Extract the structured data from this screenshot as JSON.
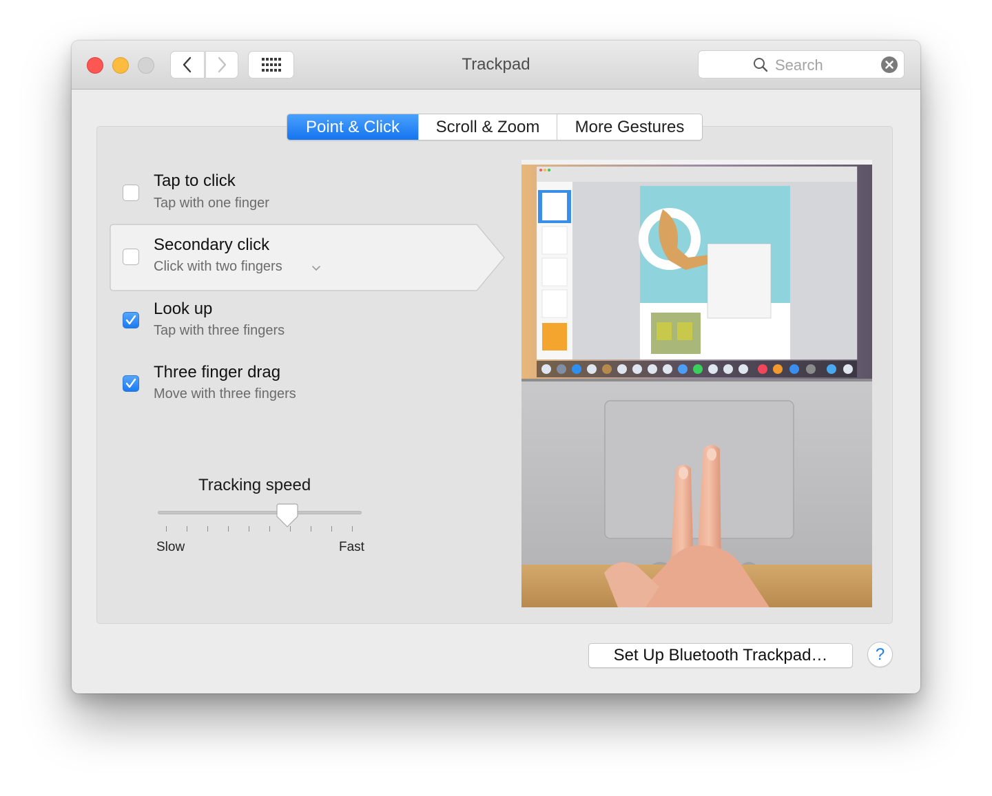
{
  "window": {
    "title": "Trackpad"
  },
  "toolbar": {
    "back_icon": "chevron-left-icon",
    "forward_icon": "chevron-right-icon",
    "show_all_icon": "grid-icon"
  },
  "search": {
    "placeholder": "Search",
    "value": ""
  },
  "tabs": [
    {
      "label": "Point & Click",
      "active": true
    },
    {
      "label": "Scroll & Zoom",
      "active": false
    },
    {
      "label": "More Gestures",
      "active": false
    }
  ],
  "options": [
    {
      "label": "Tap to click",
      "sub": "Tap with one finger",
      "checked": false
    },
    {
      "label": "Secondary click",
      "sub": "Click with two fingers",
      "checked": false,
      "selected": true
    },
    {
      "label": "Look up",
      "sub": "Tap with three fingers",
      "checked": true
    },
    {
      "label": "Three finger drag",
      "sub": "Move with three fingers",
      "checked": true
    }
  ],
  "tracking": {
    "label": "Tracking speed",
    "min_label": "Slow",
    "max_label": "Fast",
    "value_fraction": 0.65,
    "tick_count": 10
  },
  "footer": {
    "bluetooth_button": "Set Up Bluetooth Trackpad…",
    "help_button": "?"
  },
  "colors": {
    "accent": "#1a7cf2",
    "close": "#fc5753",
    "minimize": "#fdbc40",
    "zoom_disabled": "#d3d3d3"
  }
}
